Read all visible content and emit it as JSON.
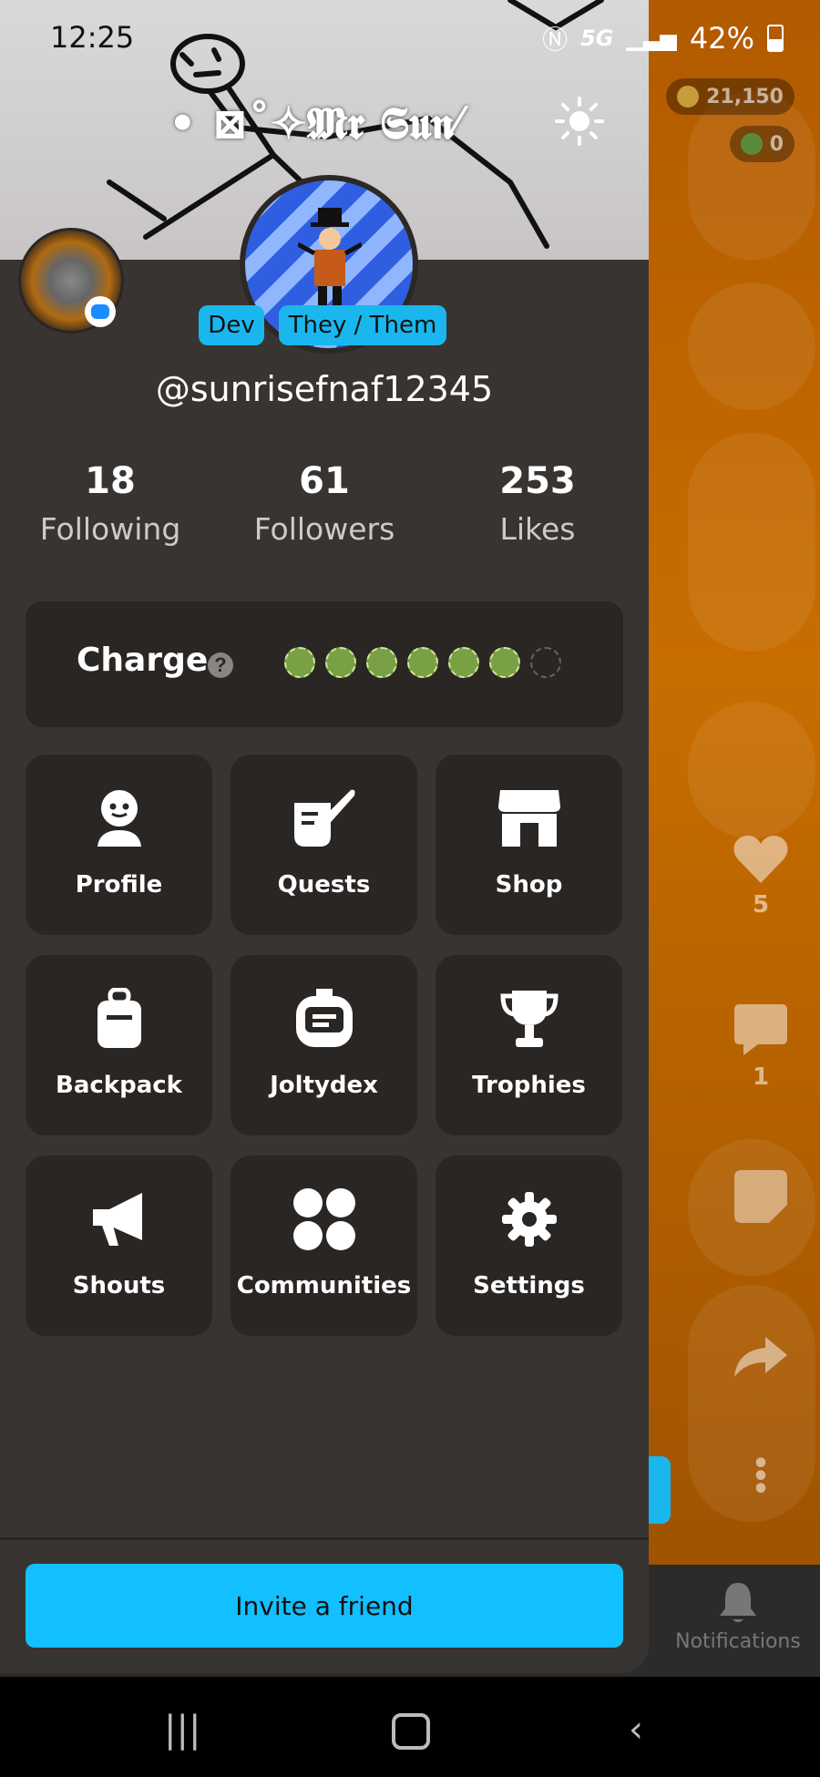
{
  "status_bar": {
    "time": "12:25",
    "network": "5G",
    "battery": "42%"
  },
  "banner": {
    "title": "• ⊠˚✧𝕸𝖗 𝕾𝖚𝖓⁄"
  },
  "background_app": {
    "coins": "21,150",
    "gems": "0",
    "likes_count": "5",
    "comments_count": "1",
    "notifications_label": "Notifications"
  },
  "profile": {
    "badges": [
      "Dev",
      "They / Them"
    ],
    "username": "@sunrisefnaf12345"
  },
  "stats": [
    {
      "value": "18",
      "label": "Following"
    },
    {
      "value": "61",
      "label": "Followers"
    },
    {
      "value": "253",
      "label": "Likes"
    }
  ],
  "charge": {
    "label": "Charge",
    "help": "?",
    "filled": 6,
    "total": 7
  },
  "menu": [
    {
      "label": "Profile",
      "icon": "profile-icon"
    },
    {
      "label": "Quests",
      "icon": "quests-icon"
    },
    {
      "label": "Shop",
      "icon": "shop-icon"
    },
    {
      "label": "Backpack",
      "icon": "backpack-icon"
    },
    {
      "label": "Joltydex",
      "icon": "joltydex-icon"
    },
    {
      "label": "Trophies",
      "icon": "trophy-icon"
    },
    {
      "label": "Shouts",
      "icon": "megaphone-icon"
    },
    {
      "label": "Communities",
      "icon": "communities-icon"
    },
    {
      "label": "Settings",
      "icon": "gear-icon"
    }
  ],
  "invite_button": {
    "label": "Invite a friend"
  },
  "colors": {
    "accent": "#12c0ff",
    "drawer_bg": "#383431",
    "tile_bg": "#2a2624"
  }
}
